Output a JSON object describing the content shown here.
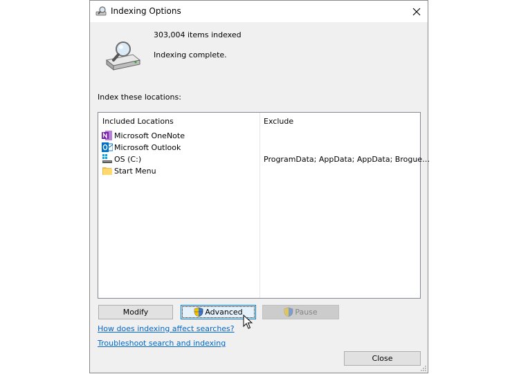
{
  "window": {
    "title": "Indexing Options"
  },
  "status": {
    "items_indexed": "303,004 items indexed",
    "state": "Indexing complete."
  },
  "locations": {
    "label": "Index these locations:",
    "columns": {
      "included": "Included Locations",
      "exclude": "Exclude"
    },
    "rows": [
      {
        "name": "Microsoft OneNote",
        "exclude": "",
        "icon": "onenote-icon"
      },
      {
        "name": "Microsoft Outlook",
        "exclude": "",
        "icon": "outlook-icon"
      },
      {
        "name": "OS (C:)",
        "exclude": "ProgramData; AppData; AppData; Brogue…",
        "icon": "drive-icon"
      },
      {
        "name": "Start Menu",
        "exclude": "",
        "icon": "folder-icon"
      }
    ]
  },
  "buttons": {
    "modify": "Modify",
    "advanced": "Advanced",
    "pause": "Pause",
    "close": "Close"
  },
  "links": {
    "how_affects": "How does indexing affect searches?",
    "troubleshoot": "Troubleshoot search and indexing"
  },
  "colors": {
    "onenote": "#7719aa",
    "outlook": "#0072c6",
    "link": "#0066cc",
    "focus_border": "#0078d7"
  }
}
